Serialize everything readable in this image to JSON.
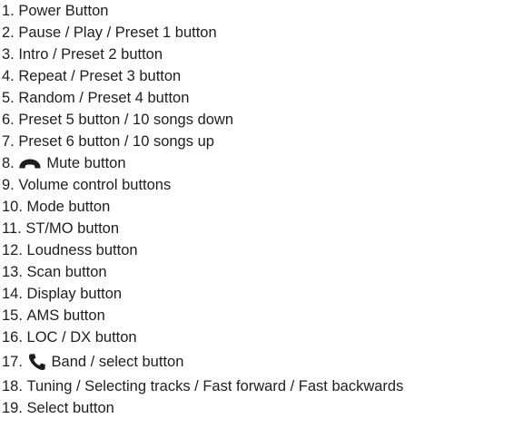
{
  "legend": {
    "items": [
      {
        "number": "1.",
        "label": "Power Button"
      },
      {
        "number": "2.",
        "label": "Pause / Play / Preset 1 button"
      },
      {
        "number": "3.",
        "label": "Intro / Preset 2 button"
      },
      {
        "number": "4.",
        "label": "Repeat / Preset 3 button"
      },
      {
        "number": "5.",
        "label": "Random / Preset 4 button"
      },
      {
        "number": "6.",
        "label": "Preset 5 button / 10 songs down"
      },
      {
        "number": "7.",
        "label": "Preset 6 button / 10 songs up"
      },
      {
        "number": "8.",
        "label": "Mute button",
        "icon": "hang-up-phone-icon"
      },
      {
        "number": "9.",
        "label": "Volume control buttons"
      },
      {
        "number": "10.",
        "label": "Mode button"
      },
      {
        "number": "11.",
        "label": "ST/MO button"
      },
      {
        "number": "12.",
        "label": "Loudness button"
      },
      {
        "number": "13.",
        "label": "Scan button"
      },
      {
        "number": "14.",
        "label": "Display button"
      },
      {
        "number": "15.",
        "label": "AMS button"
      },
      {
        "number": "16.",
        "label": "LOC / DX button"
      },
      {
        "number": "17.",
        "label": "Band / select button",
        "icon": "phone-call-icon"
      },
      {
        "number": "18.",
        "label": "Tuning / Selecting tracks / Fast forward / Fast backwards"
      },
      {
        "number": "19.",
        "label": "Select button"
      }
    ]
  }
}
